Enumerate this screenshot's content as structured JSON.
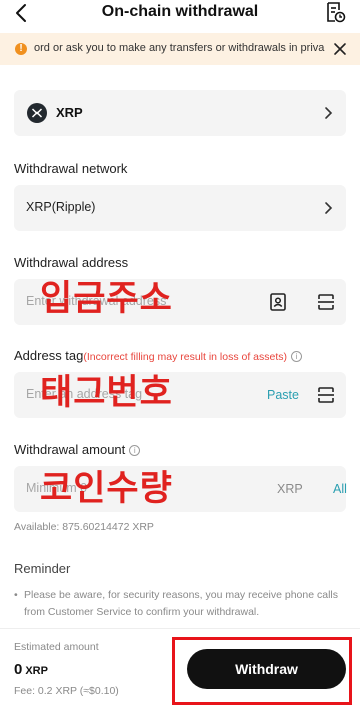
{
  "header": {
    "title": "On-chain withdrawal",
    "back_icon": "chevron-left-icon",
    "record_icon": "history-document-icon"
  },
  "banner": {
    "text": "ord or ask you to make any transfers or withdrawals in priva",
    "warn_icon": "warning-icon",
    "close_icon": "close-icon"
  },
  "coin": {
    "name": "XRP"
  },
  "network": {
    "label": "Withdrawal network",
    "value": "XRP(Ripple)"
  },
  "address": {
    "label": "Withdrawal address",
    "placeholder": "Enter withdrawal address",
    "overlay": "입금주소"
  },
  "tag": {
    "label": "Address tag",
    "warning": "(Incorrect filling may result in loss of assets)",
    "placeholder": "Enter an address tag",
    "paste_label": "Paste",
    "overlay": "태그번호"
  },
  "amount": {
    "label": "Withdrawal amount",
    "placeholder": "Minimum 0",
    "unit": "XRP",
    "all_label": "All",
    "overlay": "코인수량"
  },
  "available": "Available: 875.60214472 XRP",
  "reminder": {
    "title": "Reminder",
    "text": "Please be aware, for security reasons, you may receive phone calls from Customer Service to confirm your withdrawal."
  },
  "footer": {
    "estimated_label": "Estimated amount",
    "estimated_value": "0",
    "estimated_unit": "XRP",
    "fee": "Fee: 0.2 XRP (≈$0.10)",
    "withdraw_label": "Withdraw"
  },
  "colors": {
    "accent": "#2a9fb1",
    "warning": "#e8453c",
    "highlight": "#e8141a",
    "overlay_text": "#e0221f",
    "banner_bg": "#fdf1e2"
  }
}
